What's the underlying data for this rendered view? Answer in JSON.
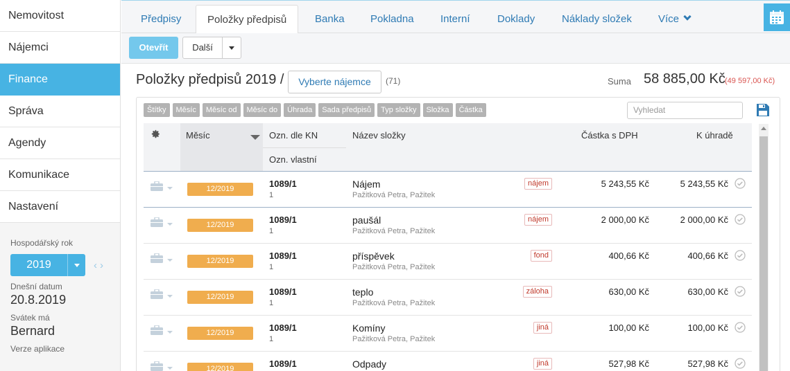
{
  "sidebar": {
    "items": [
      {
        "label": "Nemovitost"
      },
      {
        "label": "Nájemci"
      },
      {
        "label": "Finance"
      },
      {
        "label": "Správa"
      },
      {
        "label": "Agendy"
      },
      {
        "label": "Komunikace"
      },
      {
        "label": "Nastavení"
      }
    ],
    "active_index": 2,
    "fiscal_year_label": "Hospodářský rok",
    "fiscal_year_value": "2019",
    "today_label": "Dnešní datum",
    "today_value": "20.8.2019",
    "nameday_label": "Svátek má",
    "nameday_value": "Bernard",
    "version_label": "Verze aplikace"
  },
  "tabs": [
    {
      "label": "Předpisy"
    },
    {
      "label": "Položky předpisů"
    },
    {
      "label": "Banka"
    },
    {
      "label": "Pokladna"
    },
    {
      "label": "Interní"
    },
    {
      "label": "Doklady"
    },
    {
      "label": "Náklady složek"
    },
    {
      "label": "Více"
    }
  ],
  "active_tab": 1,
  "toolbar": {
    "open_label": "Otevřít",
    "more_label": "Další"
  },
  "header": {
    "title": "Položky předpisů 2019 /",
    "tenant_button": "Vyberte nájemce",
    "count": "(71)",
    "sum_label": "Suma",
    "sum_value": "58 885,00 Kč",
    "sum_remaining": "(49 597,00 Kč)"
  },
  "filters": [
    "Štítky",
    "Měsíc",
    "Měsíc od",
    "Měsíc do",
    "Úhrada",
    "Sada předpisů",
    "Typ složky",
    "Složka",
    "Částka"
  ],
  "search": {
    "placeholder": "Vyhledat"
  },
  "columns": {
    "month": "Měsíc",
    "kn": "Ozn. dle KN",
    "own": "Ozn. vlastní",
    "name": "Název složky",
    "amount": "Částka s DPH",
    "to_pay": "K úhradě"
  },
  "rows": [
    {
      "month": "12/2019",
      "kn": "1089/1",
      "own": "1",
      "name": "Nájem",
      "sub": "Pažitková Petra, Pažitek",
      "tag": "nájem",
      "amount": "5 243,55 Kč",
      "to_pay": "5 243,55 Kč"
    },
    {
      "month": "12/2019",
      "kn": "1089/1",
      "own": "1",
      "name": "paušál",
      "sub": "Pažitková Petra, Pažitek",
      "tag": "nájem",
      "amount": "2 000,00 Kč",
      "to_pay": "2 000,00 Kč"
    },
    {
      "month": "12/2019",
      "kn": "1089/1",
      "own": "1",
      "name": "příspěvek",
      "sub": "Pažitková Petra, Pažitek",
      "tag": "fond",
      "amount": "400,66 Kč",
      "to_pay": "400,66 Kč"
    },
    {
      "month": "12/2019",
      "kn": "1089/1",
      "own": "1",
      "name": "teplo",
      "sub": "Pažitková Petra, Pažitek",
      "tag": "záloha",
      "amount": "630,00 Kč",
      "to_pay": "630,00 Kč"
    },
    {
      "month": "12/2019",
      "kn": "1089/1",
      "own": "1",
      "name": "Komíny",
      "sub": "Pažitková Petra, Pažitek",
      "tag": "jiná",
      "amount": "100,00 Kč",
      "to_pay": "100,00 Kč"
    },
    {
      "month": "12/2019",
      "kn": "1089/1",
      "own": "",
      "name": "Odpady",
      "sub": "",
      "tag": "jiná",
      "amount": "527,98 Kč",
      "to_pay": "527,98 Kč"
    }
  ],
  "colors": {
    "accent": "#47b3e3",
    "badge": "#f0ad4e",
    "link": "#2f7bb4",
    "negative": "#d9534f"
  }
}
